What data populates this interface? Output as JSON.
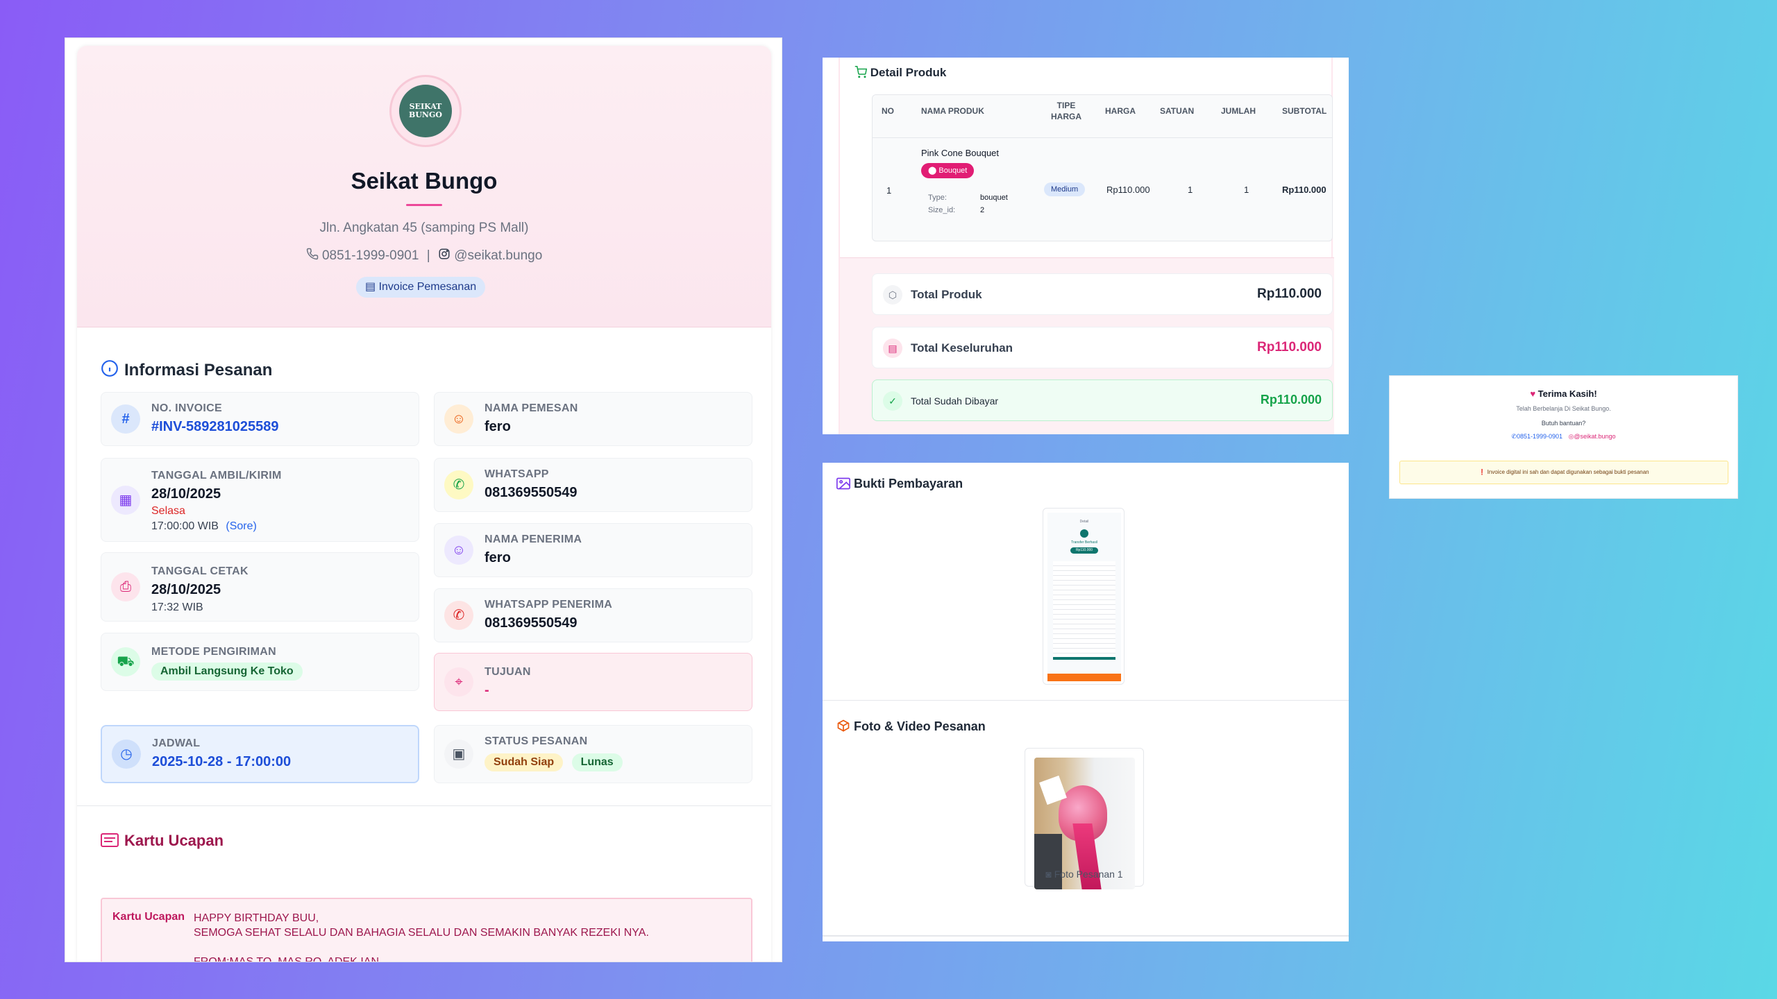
{
  "store": {
    "name": "Seikat Bungo",
    "logo_text": "SEIKAT BUNGO",
    "address": "Jln. Angkatan 45 (samping PS Mall)",
    "phone": "0851-1999-0901",
    "separator": "|",
    "instagram": "@seikat.bungo",
    "badge": "Invoice Pemesanan"
  },
  "info": {
    "title": "Informasi Pesanan",
    "invoice_label": "NO. INVOICE",
    "invoice_value": "#INV-589281025589",
    "pemesan_label": "NAMA PEMESAN",
    "pemesan_value": "fero",
    "tanggal_label": "TANGGAL AMBIL/KIRIM",
    "tanggal_value": "28/10/2025",
    "tanggal_day": "Selasa",
    "tanggal_time": "17:00:00 WIB",
    "tanggal_slot": "(Sore)",
    "wa_label": "WHATSAPP",
    "wa_value": "081369550549",
    "penerima_label": "NAMA PENERIMA",
    "penerima_value": "fero",
    "cetak_label": "TANGGAL CETAK",
    "cetak_value": "28/10/2025",
    "cetak_time": "17:32 WIB",
    "wa_penerima_label": "WHATSAPP PENERIMA",
    "wa_penerima_value": "081369550549",
    "metode_label": "METODE PENGIRIMAN",
    "metode_value": "Ambil Langsung Ke Toko",
    "tujuan_label": "TUJUAN",
    "tujuan_value": "-",
    "jadwal_label": "JADWAL",
    "jadwal_value": "2025-10-28 - 17:00:00",
    "status_label": "STATUS PESANAN",
    "status_ready": "Sudah Siap",
    "status_paid": "Lunas"
  },
  "greeting": {
    "title": "Kartu Ucapan",
    "label": "Kartu Ucapan",
    "line1": "HAPPY BIRTHDAY BUU,",
    "line2": "SEMOGA SEHAT SELALU DAN BAHAGIA SELALU DAN SEMAKIN BANYAK REZEKI NYA.",
    "line3": "FROM:MAS TO, MAS RO, ADEK IAN"
  },
  "product": {
    "title": "Detail Produk",
    "headers": {
      "no": "NO",
      "nama": "NAMA PRODUK",
      "tipe1": "TIPE",
      "tipe2": "HARGA",
      "harga": "HARGA",
      "satuan": "SATUAN",
      "jumlah": "JUMLAH",
      "subtotal": "SUBTOTAL"
    },
    "row": {
      "no": "1",
      "name": "Pink Cone Bouquet",
      "category": "Bouquet",
      "type_label": "Type:",
      "type_value": "bouquet",
      "size_label": "Size_id:",
      "size_value": "2",
      "tipe": "Medium",
      "harga": "Rp110.000",
      "satuan": "1",
      "jumlah": "1",
      "subtotal": "Rp110.000"
    }
  },
  "totals": {
    "produk_label": "Total Produk",
    "produk_value": "Rp110.000",
    "all_label": "Total Keseluruhan",
    "all_value": "Rp110.000",
    "paid_label": "Total Sudah Dibayar",
    "paid_value": "Rp110.000"
  },
  "bukti": {
    "title": "Bukti Pembayaran",
    "amount": "Rp110.000",
    "header": "Detail",
    "heading": "Transfer Berhasil"
  },
  "media": {
    "title": "Foto & Video Pesanan",
    "caption": "Foto Pesanan 1"
  },
  "thanks": {
    "title": "Terima Kasih!",
    "line": "Telah Berbelanja Di Seikat Bungo.",
    "help": "Butuh bantuan?",
    "phone": "0851-1999-0901",
    "ig": "@seikat.bungo",
    "note": "Invoice digital ini sah dan dapat digunakan sebagai bukti pesanan"
  },
  "colors": {
    "pink": "#ec4899",
    "blue": "#2563eb",
    "green": "#16a34a"
  }
}
